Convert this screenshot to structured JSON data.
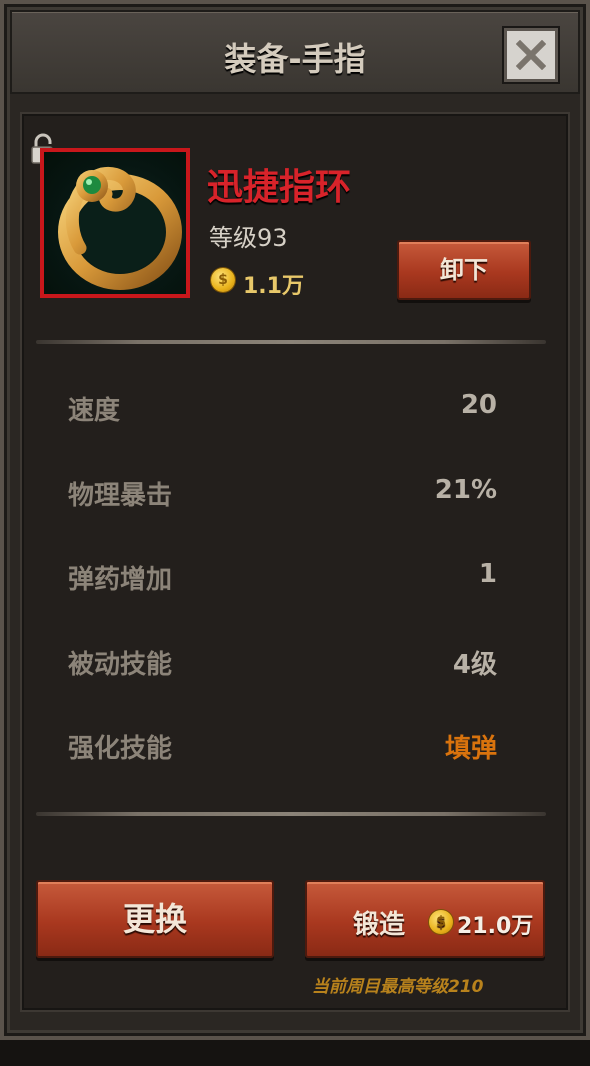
{
  "header": {
    "title": "装备-手指"
  },
  "item": {
    "name": "迅捷指环",
    "level": "等级93",
    "price": "1.1万",
    "coin_symbol": "$",
    "unequip_label": "卸下",
    "name_color": "#d8232a"
  },
  "stats": [
    {
      "label": "速度",
      "value": "20"
    },
    {
      "label": "物理暴击",
      "value": "21%"
    },
    {
      "label": "弹药增加",
      "value": "1"
    },
    {
      "label": "被动技能",
      "value": "4级"
    },
    {
      "label": "强化技能",
      "value": "填弹",
      "highlight": "#d9730d"
    }
  ],
  "actions": {
    "replace_label": "更换",
    "forge_label": "锻造",
    "forge_cost": "21.0万",
    "max_level_note": "当前周目最高等级210"
  },
  "icons": {
    "close": "close-icon",
    "lock": "lock-icon",
    "ring": "ring-icon",
    "coin": "coin-icon"
  }
}
